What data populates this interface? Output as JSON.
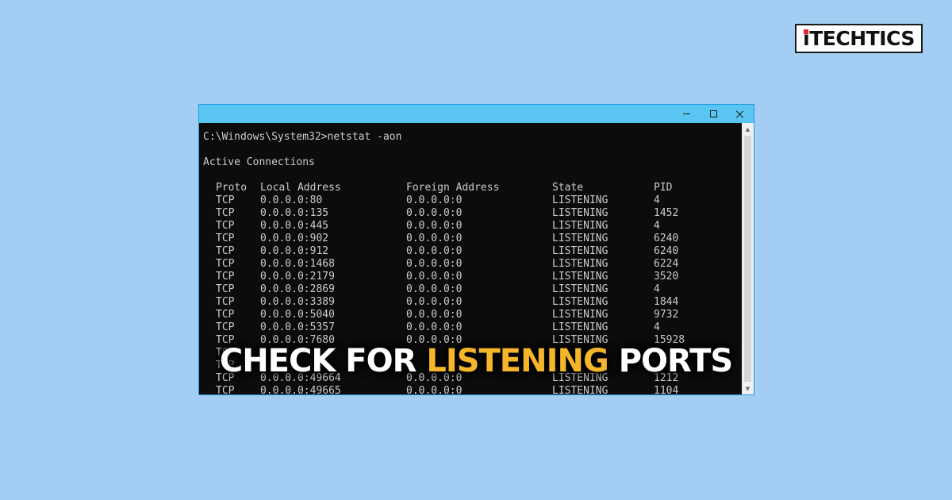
{
  "logo": {
    "first": "i",
    "rest": "TECHTICS",
    "accent_color": "#e3262b"
  },
  "window": {
    "title": "",
    "controls": {
      "minimize": "minimize-icon",
      "maximize": "maximize-icon",
      "close": "close-icon"
    },
    "prompt": "C:\\Windows\\System32>netstat -aon",
    "section_title": "Active Connections",
    "columns": [
      "Proto",
      "Local Address",
      "Foreign Address",
      "State",
      "PID"
    ],
    "rows": [
      [
        "TCP",
        "0.0.0.0:80",
        "0.0.0.0:0",
        "LISTENING",
        "4"
      ],
      [
        "TCP",
        "0.0.0.0:135",
        "0.0.0.0:0",
        "LISTENING",
        "1452"
      ],
      [
        "TCP",
        "0.0.0.0:445",
        "0.0.0.0:0",
        "LISTENING",
        "4"
      ],
      [
        "TCP",
        "0.0.0.0:902",
        "0.0.0.0:0",
        "LISTENING",
        "6240"
      ],
      [
        "TCP",
        "0.0.0.0:912",
        "0.0.0.0:0",
        "LISTENING",
        "6240"
      ],
      [
        "TCP",
        "0.0.0.0:1468",
        "0.0.0.0:0",
        "LISTENING",
        "6224"
      ],
      [
        "TCP",
        "0.0.0.0:2179",
        "0.0.0.0:0",
        "LISTENING",
        "3520"
      ],
      [
        "TCP",
        "0.0.0.0:2869",
        "0.0.0.0:0",
        "LISTENING",
        "4"
      ],
      [
        "TCP",
        "0.0.0.0:3389",
        "0.0.0.0:0",
        "LISTENING",
        "1844"
      ],
      [
        "TCP",
        "0.0.0.0:5040",
        "0.0.0.0:0",
        "LISTENING",
        "9732"
      ],
      [
        "TCP",
        "0.0.0.0:5357",
        "0.0.0.0:0",
        "LISTENING",
        "4"
      ],
      [
        "TCP",
        "0.0.0.0:7680",
        "0.0.0.0:0",
        "LISTENING",
        "15928"
      ],
      [
        "TCP",
        "",
        "",
        "",
        ""
      ],
      [
        "TCP",
        "",
        "",
        "",
        ""
      ],
      [
        "TCP",
        "0.0.0.0:49664",
        "0.0.0.0:0",
        "LISTENING",
        "1212"
      ],
      [
        "TCP",
        "0.0.0.0:49665",
        "0.0.0.0:0",
        "LISTENING",
        "1104"
      ]
    ],
    "colors": {
      "titlebar": "#5bc5f2",
      "console_bg": "#0c0c0c",
      "console_text": "#cccccc"
    }
  },
  "headline": {
    "part1": "CHECK FOR ",
    "highlight": "LISTENING",
    "part2": " PORTS",
    "highlight_color": "#f6b62b"
  },
  "background_color": "#a3cdf3"
}
